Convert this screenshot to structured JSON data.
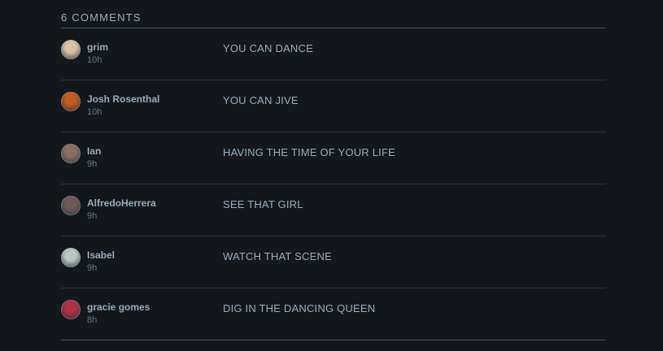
{
  "comments_heading": "6 COMMENTS",
  "comments": [
    {
      "author": "grim",
      "time": "10h",
      "text": "YOU CAN DANCE",
      "avatar_color": "#d9c2a8"
    },
    {
      "author": "Josh Rosenthal",
      "time": "10h",
      "text": "YOU CAN JIVE",
      "avatar_color": "#c45a1e"
    },
    {
      "author": "Ian",
      "time": "9h",
      "text": "HAVING THE TIME OF YOUR LIFE",
      "avatar_color": "#8a7060"
    },
    {
      "author": "AlfredoHerrera",
      "time": "9h",
      "text": "SEE THAT GIRL",
      "avatar_color": "#6b5a55"
    },
    {
      "author": "Isabel",
      "time": "9h",
      "text": "WATCH THAT SCENE",
      "avatar_color": "#b8c8c0"
    },
    {
      "author": "gracie gomes",
      "time": "8h",
      "text": "DIG IN THE DANCING QUEEN",
      "avatar_color": "#b03048"
    }
  ]
}
